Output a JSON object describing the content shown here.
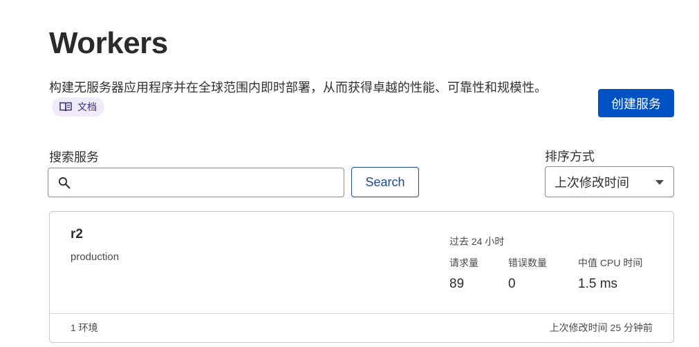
{
  "header": {
    "title": "Workers",
    "description": "构建无服务器应用程序并在全球范围内即时部署，从而获得卓越的性能、可靠性和规模性。",
    "docs_label": "文档",
    "create_button": "创建服务"
  },
  "search": {
    "label": "搜索服务",
    "value": "",
    "placeholder": "",
    "button": "Search"
  },
  "sort": {
    "label": "排序方式",
    "selected": "上次修改时间"
  },
  "services": [
    {
      "name": "r2",
      "environment": "production",
      "period": "过去 24 小时",
      "metrics": [
        {
          "label": "请求量",
          "value": "89"
        },
        {
          "label": "错误数量",
          "value": "0"
        },
        {
          "label": "中值 CPU 时间",
          "value": "1.5 ms"
        }
      ],
      "env_count": "1 环境",
      "modified": "上次修改时间 25 分钟前"
    }
  ],
  "colors": {
    "primary": "#0051c3",
    "docs_pill_bg": "#f1ecfb",
    "docs_pill_text": "#3b2a84"
  },
  "icons": {
    "docs": "book-open-icon",
    "search": "search-icon",
    "sort": "caret-down-icon"
  }
}
